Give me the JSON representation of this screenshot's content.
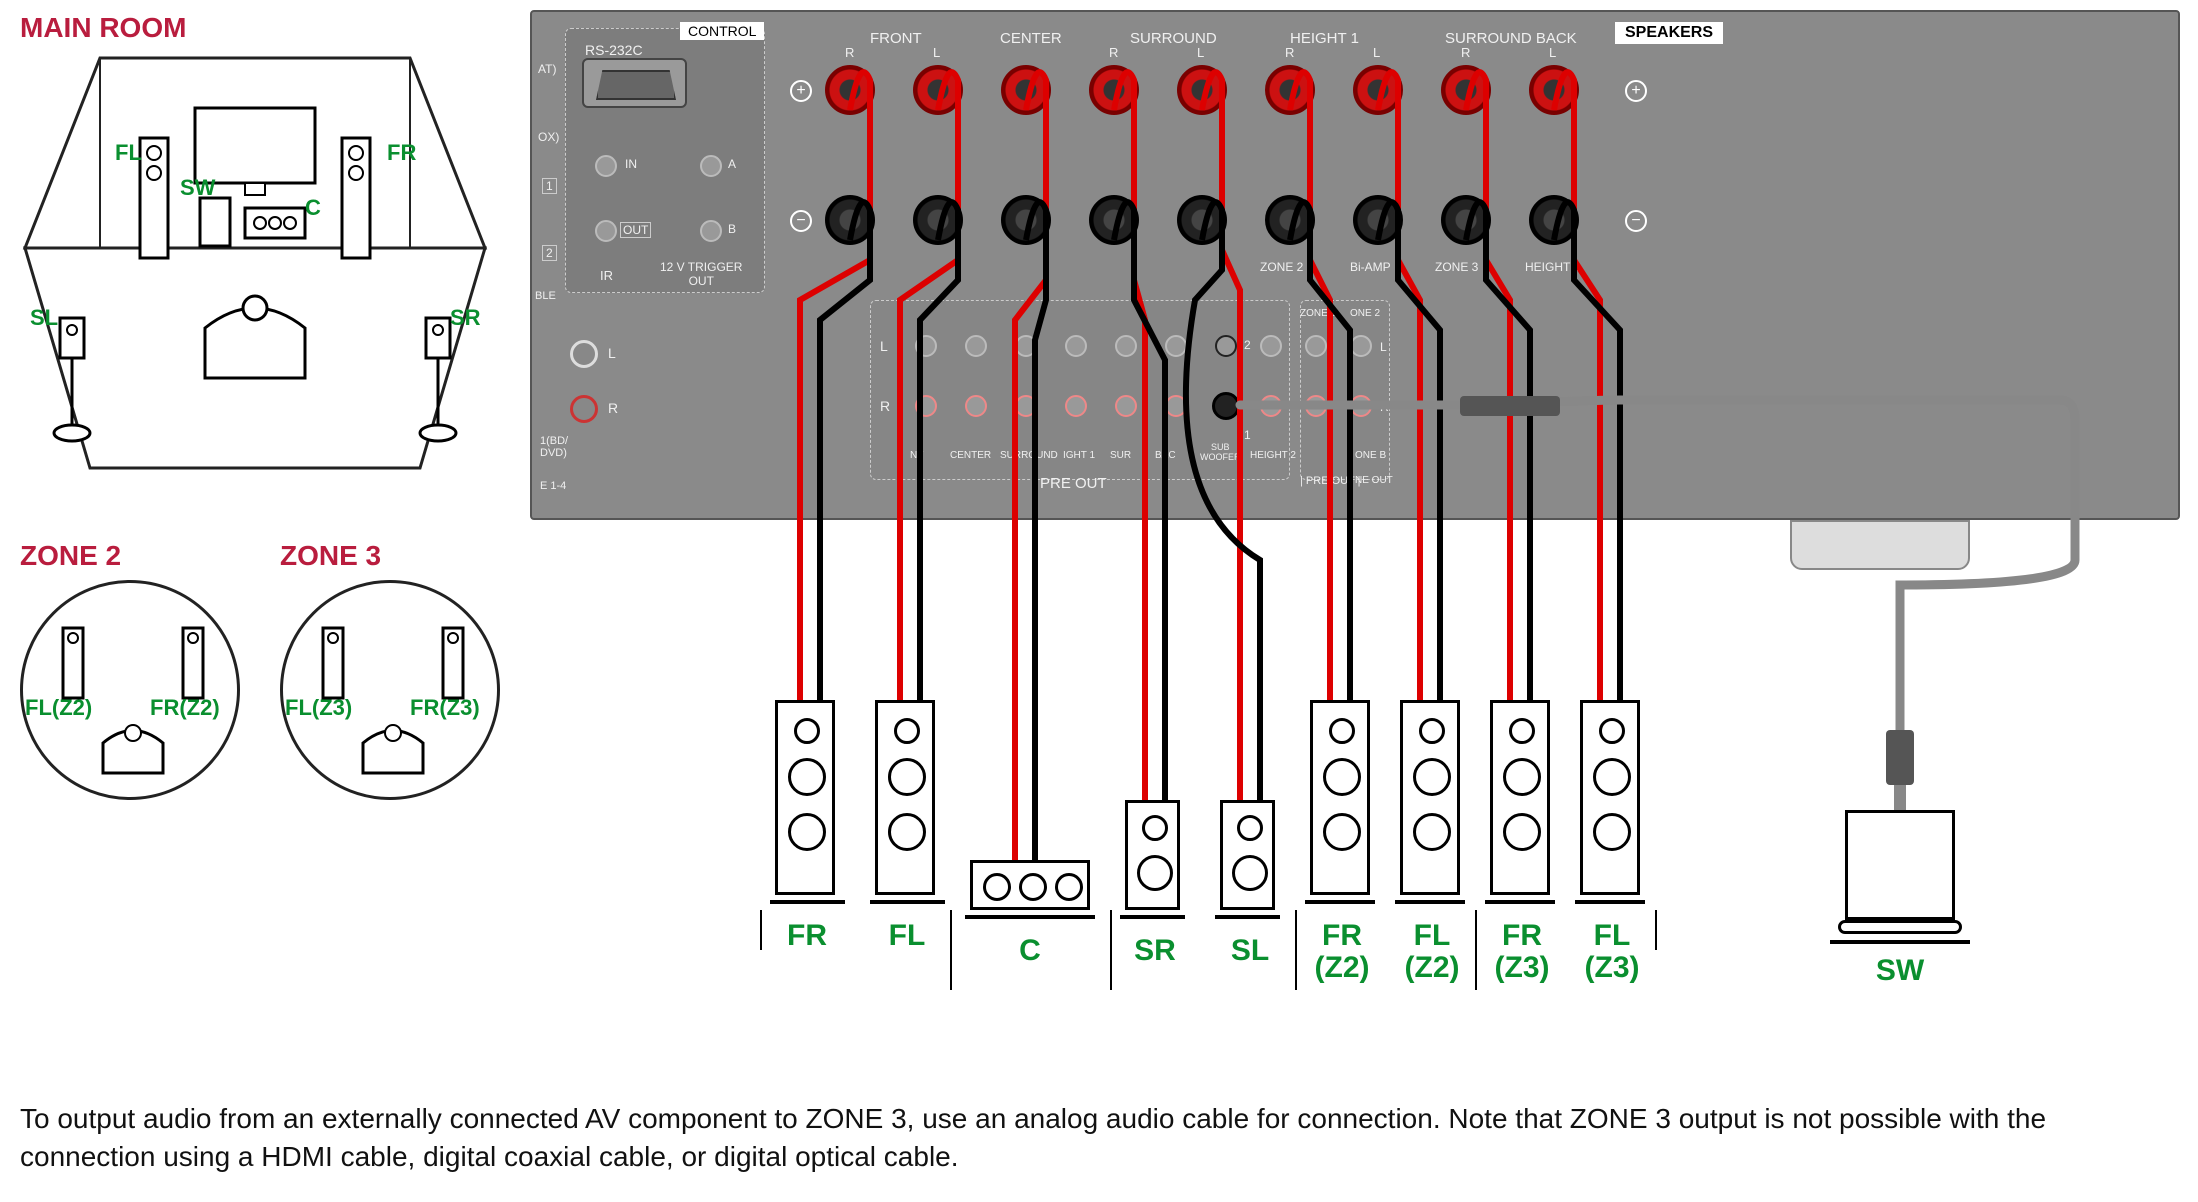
{
  "headings": {
    "main_room": "MAIN ROOM",
    "zone2": "ZONE 2",
    "zone3": "ZONE 3"
  },
  "main_room_labels": {
    "fl": "FL",
    "fr": "FR",
    "sw": "SW",
    "c": "C",
    "sl": "SL",
    "sr": "SR"
  },
  "zone2_labels": {
    "fl": "FL(Z2)",
    "fr": "FR(Z2)"
  },
  "zone3_labels": {
    "fl": "FL(Z3)",
    "fr": "FR(Z3)"
  },
  "receiver": {
    "control": "CONTROL",
    "rs232c": "RS-232C",
    "ir_in": "IN",
    "ir_out": "OUT",
    "ir": "IR",
    "trigger": "12 V TRIGGER\nOUT",
    "speakers_tag": "SPEAKERS",
    "groups": [
      "FRONT",
      "CENTER",
      "SURROUND",
      "HEIGHT 1",
      "SURROUND BACK"
    ],
    "group_lr": {
      "r": "R",
      "l": "L"
    },
    "sub_labels": {
      "zone2": "ZONE 2",
      "biamp": "Bi-AMP",
      "zone3": "ZONE 3",
      "height2": "HEIGHT 2"
    },
    "preout": "PRE OUT",
    "preout_labels": [
      "NT",
      "CENTER",
      "SURROUND",
      "IGHT 1",
      "SUR",
      "BAC",
      "SUB\nWOOFER",
      "HEIGHT 2"
    ],
    "zone_preout": {
      "zone3": "ZONE 3",
      "zone2": "ONE 2",
      "zoneB": "ONE B",
      "neout": "NE OUT",
      "preout_i": "| PRE OUT |"
    },
    "side_labels": {
      "at": "AT)",
      "ox": "OX)",
      "one": "1",
      "two": "2",
      "ble": "BLE",
      "bd": "1(BD/\nDVD)",
      "e14": "E 1-4",
      "a": "A",
      "b": "B",
      "l": "L",
      "r": "R",
      "num1": "1",
      "num2": "2"
    }
  },
  "speaker_under_labels": [
    "FR",
    "FL",
    "C",
    "SR",
    "SL",
    "FR\n(Z2)",
    "FL\n(Z2)",
    "FR\n(Z3)",
    "FL\n(Z3)",
    "SW"
  ],
  "footer": "To output audio from an externally connected AV component to ZONE 3, use an analog audio cable for connection. Note that ZONE 3 output is not possible with the connection using a HDMI cable, digital coaxial cable, or digital optical cable."
}
